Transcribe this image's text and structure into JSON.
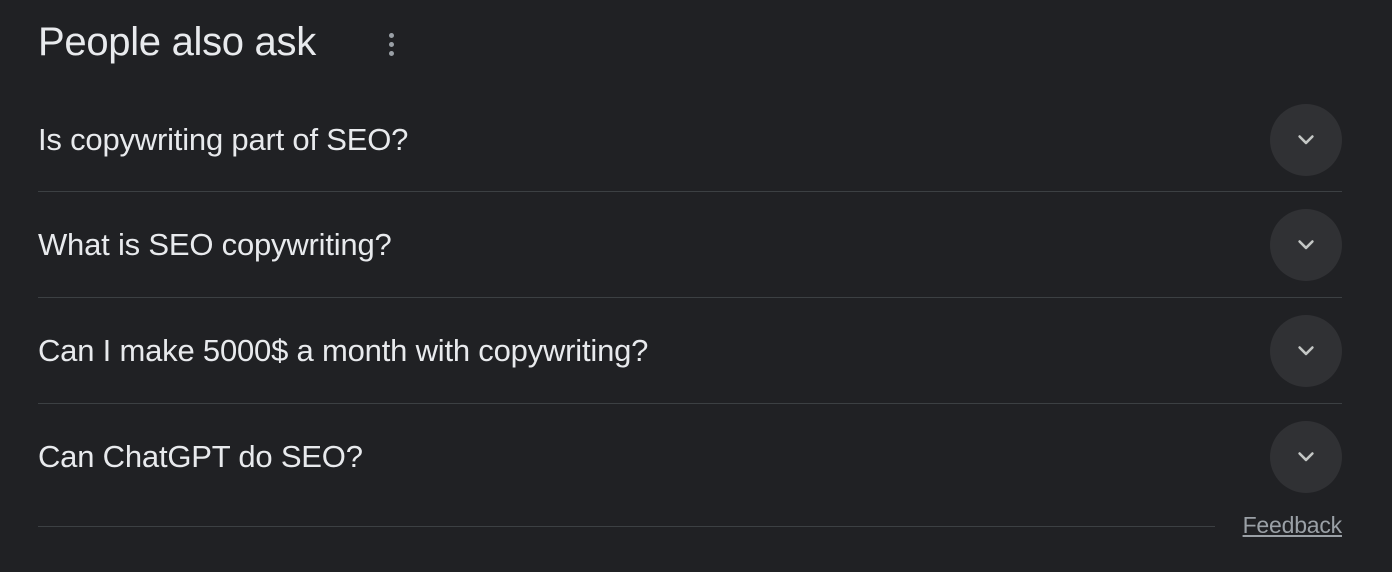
{
  "header": {
    "title": "People also ask"
  },
  "questions": [
    {
      "text": "Is copywriting part of SEO?"
    },
    {
      "text": "What is SEO copywriting?"
    },
    {
      "text": "Can I make 5000$ a month with copywriting?"
    },
    {
      "text": "Can ChatGPT do SEO?"
    }
  ],
  "footer": {
    "feedback_label": "Feedback"
  },
  "icons": {
    "more": "more-vert-icon",
    "expand": "chevron-down-icon"
  },
  "colors": {
    "background": "#202124",
    "text": "#e8eaed",
    "muted": "#9aa0a6",
    "button_bg": "#303134",
    "divider": "#3c4043"
  }
}
